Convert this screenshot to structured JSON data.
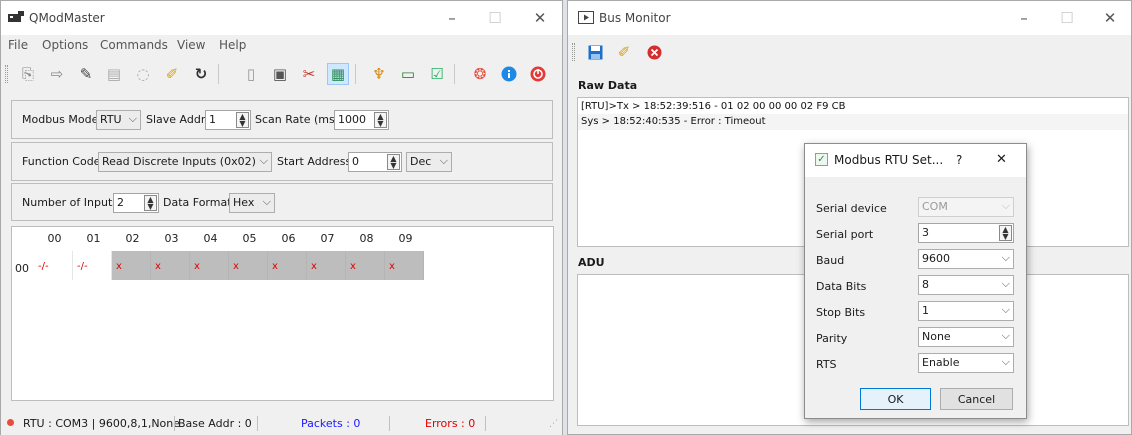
{
  "qmodmaster": {
    "title": "QModMaster",
    "menu": [
      "File",
      "Options",
      "Commands",
      "View",
      "Help"
    ],
    "toolbar_icons": [
      "connect-icon",
      "disconnect-icon",
      "read-write-icon",
      "scan-icon",
      "reset-icon",
      "clear-icon",
      "refresh-icon",
      "log-icon",
      "bus-monitor-icon",
      "tools-icon",
      "table-icon",
      "modbus-rtu-icon",
      "modbus-tcp-icon",
      "settings-icon",
      "help-icon",
      "about-icon",
      "exit-icon"
    ],
    "row1": {
      "modbus_mode_label": "Modbus Mode",
      "modbus_mode_value": "RTU",
      "slave_addr_label": "Slave Addr",
      "slave_addr_value": "1",
      "scan_rate_label": "Scan Rate (ms)",
      "scan_rate_value": "1000"
    },
    "row2": {
      "function_code_label": "Function Code",
      "function_code_value": "Read Discrete Inputs (0x02)",
      "start_address_label": "Start Address",
      "start_address_value": "0",
      "format_value": "Dec"
    },
    "row3": {
      "number_inputs_label": "Number of Inputs",
      "number_inputs_value": "2",
      "data_format_label": "Data Format",
      "data_format_value": "Hex"
    },
    "table": {
      "columns": [
        "00",
        "01",
        "02",
        "03",
        "04",
        "05",
        "06",
        "07",
        "08",
        "09"
      ],
      "row_label": "00",
      "cells": [
        "-/-",
        "-/-",
        "x",
        "x",
        "x",
        "x",
        "x",
        "x",
        "x",
        "x"
      ]
    },
    "status": {
      "connection": "RTU : COM3 | 9600,8,1,None",
      "base_addr": "Base Addr : 0",
      "packets": "Packets : 0",
      "errors": "Errors : 0"
    }
  },
  "bus_monitor": {
    "title": "Bus Monitor",
    "toolbar_icons": [
      "save-icon",
      "clear-icon",
      "exit-icon"
    ],
    "raw_data_label": "Raw Data",
    "raw_lines": [
      "[RTU]>Tx > 18:52:39:516 - 01  02  00  00  00  02  F9  CB",
      "Sys > 18:52:40:535 - Error : Timeout"
    ],
    "adu_label": "ADU"
  },
  "rtu_dialog": {
    "title": "Modbus RTU Set...",
    "help": "?",
    "close": "✕",
    "fields": [
      {
        "label": "Serial device",
        "value": "COM"
      },
      {
        "label": "Serial port",
        "value": "3"
      },
      {
        "label": "Baud",
        "value": "9600"
      },
      {
        "label": "Data Bits",
        "value": "8"
      },
      {
        "label": "Stop Bits",
        "value": "1"
      },
      {
        "label": "Parity",
        "value": "None"
      },
      {
        "label": "RTS",
        "value": "Enable"
      }
    ],
    "ok": "OK",
    "cancel": "Cancel"
  },
  "colors": {
    "error_red": "#e00000",
    "packets_blue": "#1a1aff",
    "status_dot": "#e74c3c",
    "cell_grey": "#bdbdbd"
  }
}
